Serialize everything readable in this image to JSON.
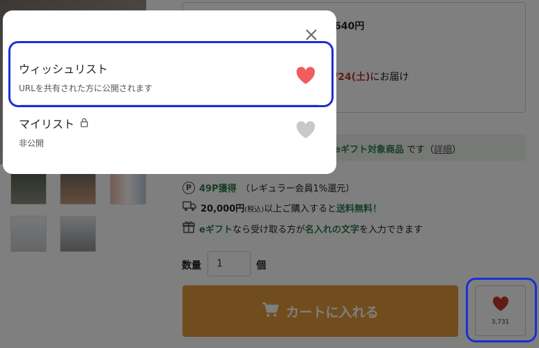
{
  "page": {
    "price": "640円",
    "delivery_date": "/24(土)",
    "delivery_suffix": "にお届け",
    "gift_band": {
      "highlight": "eギフト対象商品",
      "text": "です（",
      "link": "詳細",
      "close": "）"
    },
    "points": {
      "icon": "P",
      "earned": "49P獲得",
      "note": "（レギュラー会員1%還元）"
    },
    "shipping": {
      "amount": "20,000円",
      "tax": "(税込)",
      "middle": "以上ご購入すると",
      "free": "送料無料！"
    },
    "egift": {
      "name": "eギフト",
      "middle": "なら受け取る方が",
      "engrave": "名入れの文字",
      "suffix": "を入力できます"
    },
    "quantity": {
      "label": "数量",
      "value": "1",
      "unit": "個"
    },
    "cart_button": "カートに入れる",
    "favorite": {
      "count": "3,731"
    }
  },
  "modal": {
    "lists": [
      {
        "title": "ウィッシュリスト",
        "subtitle": "URLを共有された方に公開されます",
        "favorited": true,
        "heart_color": "#f25c5c"
      },
      {
        "title": "マイリスト",
        "subtitle": "非公開",
        "locked": true,
        "favorited": false,
        "heart_color": "#c8c8c8"
      }
    ]
  },
  "colors": {
    "highlight": "#1a2fd6",
    "cart": "#e39a3c",
    "heart_active": "#f25c5c",
    "heart_fav_page": "#c0392b",
    "heart_inactive": "#c8c8c8",
    "accent_green": "#2e7d4f",
    "accent_red": "#c0392b"
  },
  "icons": [
    "close-icon",
    "heart-icon",
    "lock-icon",
    "cart-icon",
    "point-icon",
    "truck-icon",
    "gift-icon"
  ]
}
